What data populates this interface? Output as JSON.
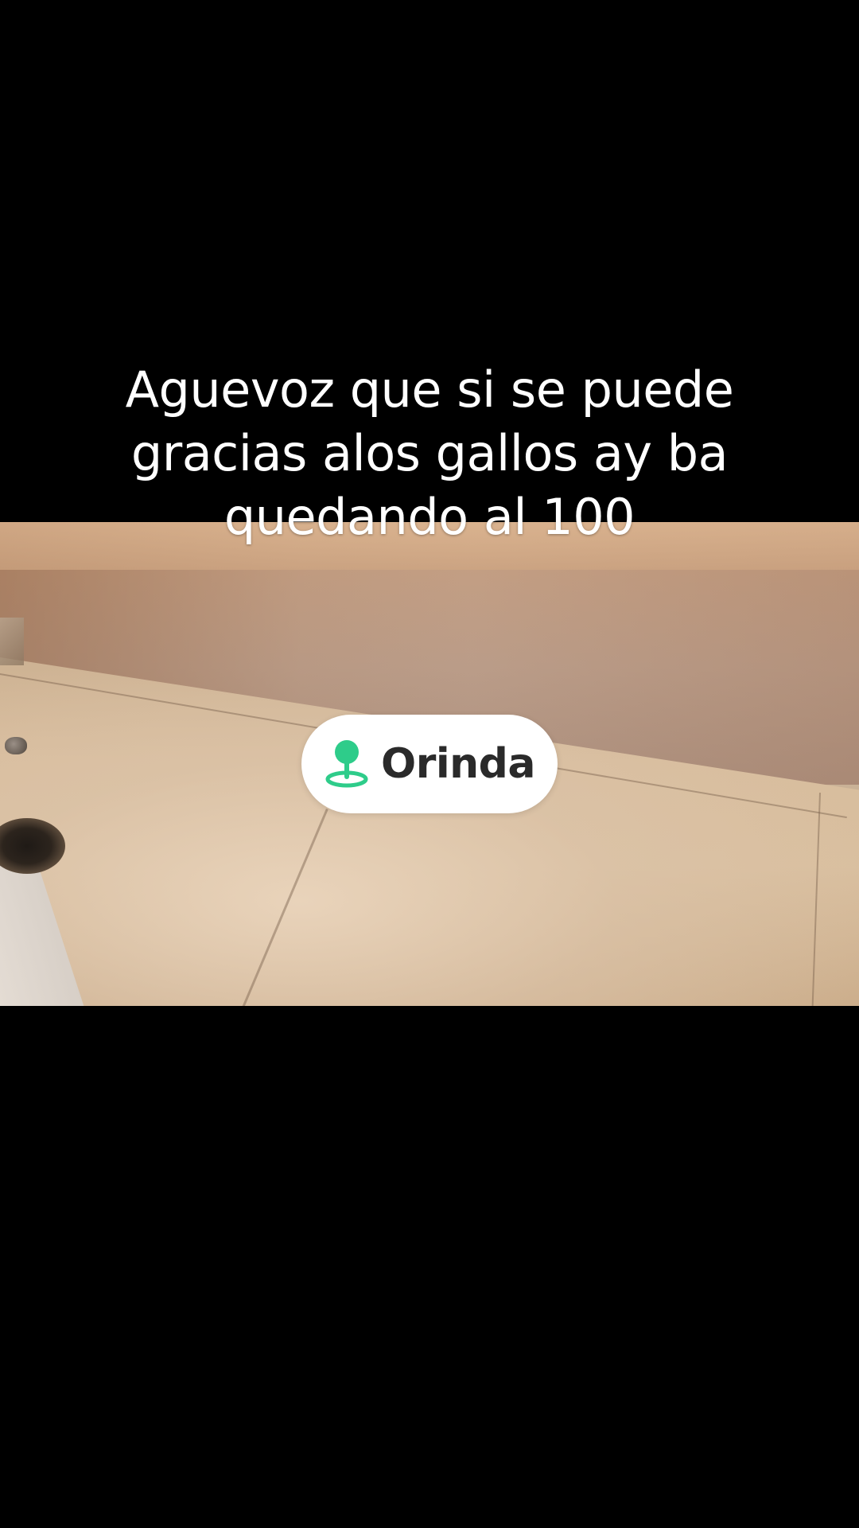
{
  "caption": {
    "lines": [
      "Aguevoz que si se puede",
      "gracias alos gallos ay ba",
      "quedando al 100"
    ]
  },
  "location_sticker": {
    "name": "Orinda",
    "icon": "location-pin-icon",
    "icon_color": "#2ecc8a"
  },
  "colors": {
    "background": "#000000",
    "caption_text": "#ffffff",
    "sticker_background": "#ffffff",
    "sticker_text": "#2a2a2a"
  }
}
